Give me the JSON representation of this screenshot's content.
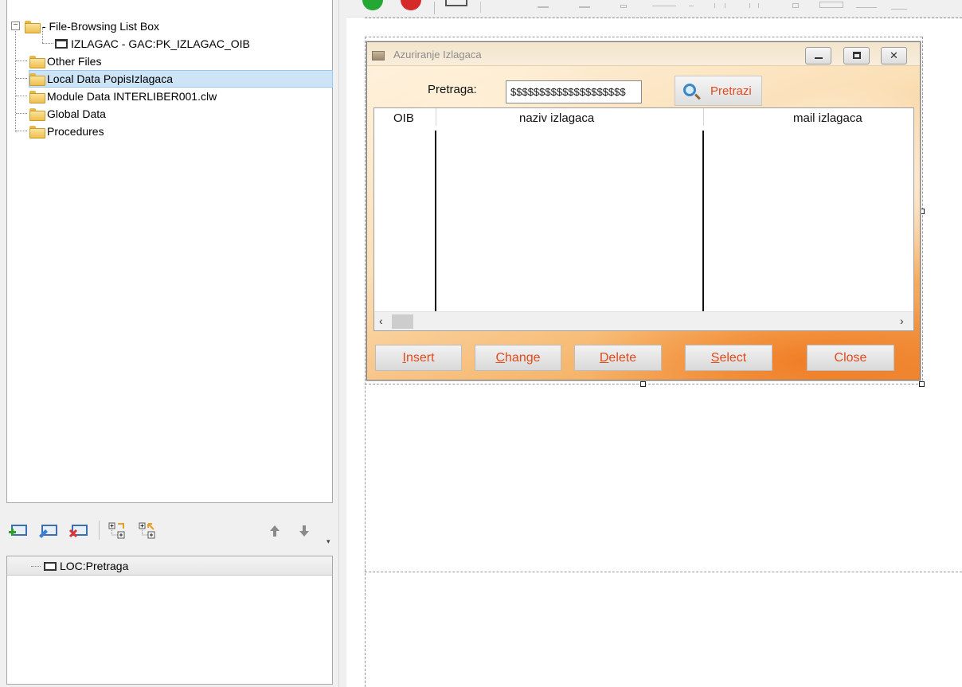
{
  "tree": {
    "root_label": " - File-Browsing List Box",
    "child_label": "IZLAGAC - GAC:PK_IZLAGAC_OIB",
    "items": [
      {
        "label": "Other Files"
      },
      {
        "label": "Local Data PopisIzlagaca"
      },
      {
        "label": "Module Data INTERLIBER001.clw"
      },
      {
        "label": "Global Data"
      },
      {
        "label": "Procedures"
      }
    ],
    "selected_item": "Local Data PopisIzlagaca"
  },
  "left_toolbar": {
    "icons": [
      "add-record-icon",
      "edit-record-icon",
      "delete-record-icon",
      "expand-tree-icon",
      "collapse-tree-icon",
      "move-up-icon",
      "move-down-icon"
    ]
  },
  "local_list": {
    "items": [
      {
        "label": "LOC:Pretraga"
      }
    ]
  },
  "window": {
    "title": "Azuriranje Izlagaca",
    "search_label": "Pretraga:",
    "search_value": "$$$$$$$$$$$$$$$$$$$$",
    "search_button": "Pretrazi",
    "columns": [
      "OIB",
      "naziv izlagaca",
      "mail izlagaca"
    ],
    "buttons": [
      {
        "hot": "I",
        "rest": "nsert"
      },
      {
        "hot": "C",
        "rest": "hange"
      },
      {
        "hot": "D",
        "rest": "elete"
      },
      {
        "hot": "S",
        "rest": "elect"
      },
      {
        "hot": "",
        "rest": "Close"
      }
    ]
  },
  "colors": {
    "accent_text": "#e24a1a",
    "selection": "#cde4f7",
    "run_green": "#22a833",
    "stop_red": "#d42a2a"
  }
}
